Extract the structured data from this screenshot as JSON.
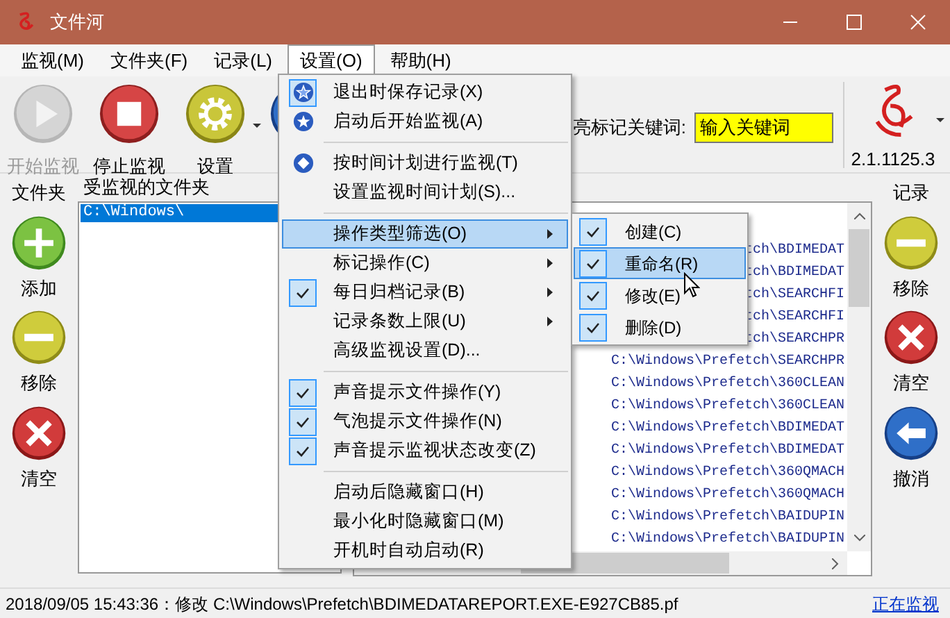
{
  "window": {
    "title": "文件河"
  },
  "menu_bar": [
    {
      "label": "监视(M)",
      "selected": false
    },
    {
      "label": "文件夹(F)",
      "selected": false
    },
    {
      "label": "记录(L)",
      "selected": false
    },
    {
      "label": "设置(O)",
      "selected": true
    },
    {
      "label": "帮助(H)",
      "selected": false
    }
  ],
  "toolbar": {
    "buttons": [
      {
        "label": "开始监视",
        "kind": "start",
        "disabled": true
      },
      {
        "label": "停止监视",
        "kind": "stop",
        "disabled": false
      },
      {
        "label": "设置",
        "kind": "settings",
        "disabled": false
      }
    ],
    "keyword": {
      "label": "亮标记关键词:",
      "value": "输入关键词"
    },
    "version": "2.1.1125.3"
  },
  "folders_panel": {
    "title": "文件夹",
    "buttons": [
      {
        "label": "添加",
        "kind": "add"
      },
      {
        "label": "移除",
        "kind": "remove"
      },
      {
        "label": "清空",
        "kind": "clear"
      }
    ]
  },
  "watched_folders": {
    "title": "受监视的文件夹",
    "items": [
      {
        "path": "C:\\Windows\\",
        "selected": true
      }
    ]
  },
  "log": {
    "rows": [
      "tch\\BDIMEDAT",
      "tch\\BDIMEDAT",
      "tch\\SEARCHFI",
      "tch\\SEARCHFI",
      "tch\\SEARCHPR",
      "C:\\Windows\\Prefetch\\SEARCHPR",
      "C:\\Windows\\Prefetch\\360CLEAN",
      "C:\\Windows\\Prefetch\\360CLEAN",
      "C:\\Windows\\Prefetch\\BDIMEDAT",
      "C:\\Windows\\Prefetch\\BDIMEDAT",
      "C:\\Windows\\Prefetch\\360QMACH",
      "C:\\Windows\\Prefetch\\360QMACH",
      "C:\\Windows\\Prefetch\\BAIDUPIN",
      "C:\\Windows\\Prefetch\\BAIDUPIN"
    ]
  },
  "records_panel": {
    "title": "记录",
    "buttons": [
      {
        "label": "移除",
        "kind": "remove"
      },
      {
        "label": "清空",
        "kind": "clear"
      },
      {
        "label": "撤消",
        "kind": "undo"
      }
    ]
  },
  "status_bar": {
    "message": "2018/09/05 15:43:36：修改 C:\\Windows\\Prefetch\\BDIMEDATAREPORT.EXE-E927CB85.pf",
    "state": "正在监视"
  },
  "settings_menu": {
    "items": [
      {
        "kind": "icon",
        "label": "退出时保存记录(X)",
        "checked": true,
        "submenu": false,
        "selected": false
      },
      {
        "kind": "icon",
        "label": "启动后开始监视(A)",
        "checked": false,
        "submenu": false,
        "selected": false
      },
      {
        "kind": "separator"
      },
      {
        "kind": "icon",
        "label": "按时间计划进行监视(T)",
        "checked": false,
        "submenu": false,
        "selected": false
      },
      {
        "kind": "item",
        "label": "设置监视时间计划(S)...",
        "checked": false,
        "submenu": false,
        "selected": false
      },
      {
        "kind": "separator"
      },
      {
        "kind": "item",
        "label": "操作类型筛选(O)",
        "checked": false,
        "submenu": true,
        "selected": true
      },
      {
        "kind": "item",
        "label": "标记操作(C)",
        "checked": false,
        "submenu": true,
        "selected": false
      },
      {
        "kind": "item",
        "label": "每日归档记录(B)",
        "checked": true,
        "submenu": true,
        "selected": false
      },
      {
        "kind": "item",
        "label": "记录条数上限(U)",
        "checked": false,
        "submenu": true,
        "selected": false
      },
      {
        "kind": "item",
        "label": "高级监视设置(D)...",
        "checked": false,
        "submenu": false,
        "selected": false
      },
      {
        "kind": "separator"
      },
      {
        "kind": "item",
        "label": "声音提示文件操作(Y)",
        "checked": true,
        "submenu": false,
        "selected": false
      },
      {
        "kind": "item",
        "label": "气泡提示文件操作(N)",
        "checked": true,
        "submenu": false,
        "selected": false
      },
      {
        "kind": "item",
        "label": "声音提示监视状态改变(Z)",
        "checked": true,
        "submenu": false,
        "selected": false
      },
      {
        "kind": "separator"
      },
      {
        "kind": "item",
        "label": "启动后隐藏窗口(H)",
        "checked": false,
        "submenu": false,
        "selected": false
      },
      {
        "kind": "item",
        "label": "最小化时隐藏窗口(M)",
        "checked": false,
        "submenu": false,
        "selected": false
      },
      {
        "kind": "item",
        "label": "开机时自动启动(R)",
        "checked": false,
        "submenu": false,
        "selected": false
      }
    ]
  },
  "filter_submenu": {
    "items": [
      {
        "label": "创建(C)",
        "checked": true,
        "selected": false
      },
      {
        "label": "重命名(R)",
        "checked": true,
        "selected": true
      },
      {
        "label": "修改(E)",
        "checked": true,
        "selected": false
      },
      {
        "label": "删除(D)",
        "checked": true,
        "selected": false
      }
    ]
  }
}
